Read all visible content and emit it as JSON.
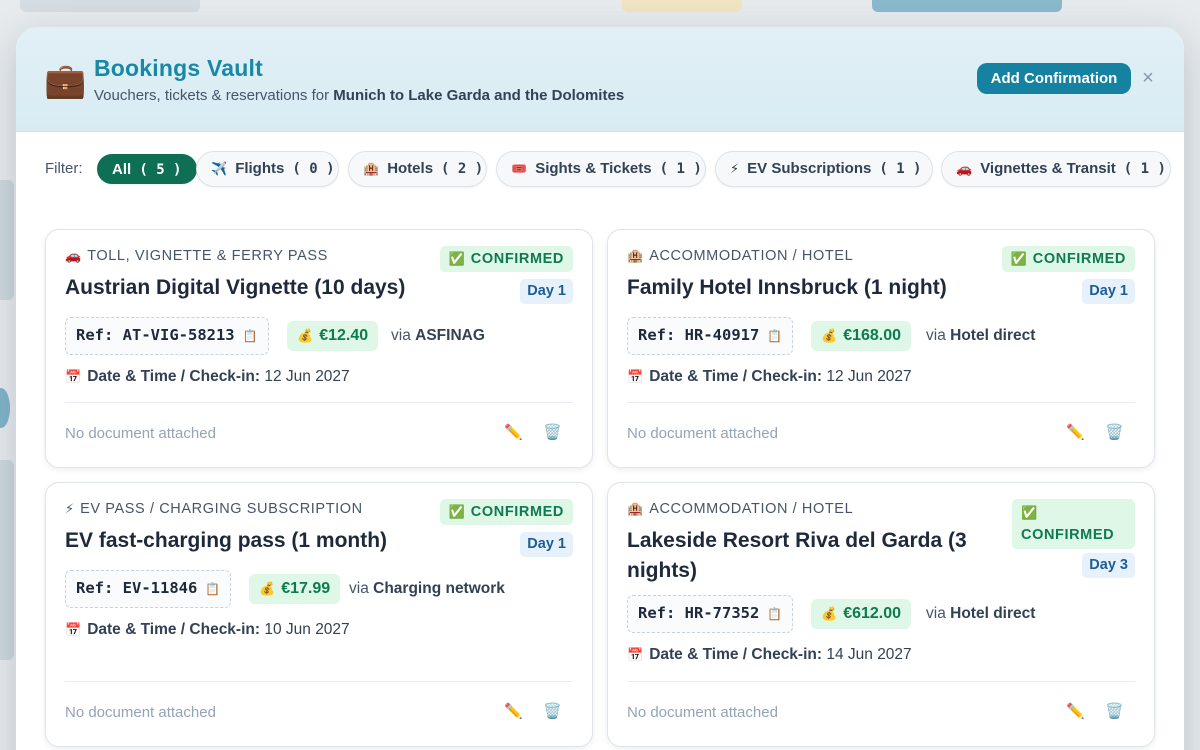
{
  "header": {
    "title": "Bookings Vault",
    "subtitle_prefix": "Vouchers, tickets & reservations for",
    "trip_name": "Munich to Lake Garda and the Dolomites",
    "add_label": "Add Confirmation",
    "close_label": "×",
    "icon": "💼"
  },
  "filters": {
    "label": "Filter:",
    "items": [
      {
        "icon": "",
        "label": "All",
        "count": "( 5 )",
        "active": true
      },
      {
        "icon": "✈️",
        "label": "Flights",
        "count": "( 0 )"
      },
      {
        "icon": "🏨",
        "label": "Hotels",
        "count": "( 2 )"
      },
      {
        "icon": "🎟️",
        "label": "Sights & Tickets",
        "count": "( 1 )"
      },
      {
        "icon": "⚡",
        "label": "EV Subscriptions",
        "count": "( 1 )"
      },
      {
        "icon": "🚗",
        "label": "Vignettes & Transit",
        "count": "( 1 )"
      }
    ]
  },
  "labels": {
    "datetime": "Date & Time / Check-in:",
    "no_doc": "No document attached",
    "via": "via",
    "edit_icon": "✏️",
    "delete_icon": "🗑️",
    "copy_icon": "📋",
    "money_icon": "💰",
    "calendar_icon": "📅",
    "check_icon": "✅"
  },
  "colors": {
    "accent": "#1582a1",
    "active_filter": "#0f6f55",
    "confirmed_bg": "#def7e7",
    "confirmed_text": "#0e7a4f",
    "day_bg": "#e7f1fb",
    "day_text": "#1d5d96"
  },
  "bookings": [
    {
      "category_icon": "🚗",
      "category": "TOLL, VIGNETTE & FERRY PASS",
      "title": "Austrian Digital Vignette (10 days)",
      "status": "CONFIRMED",
      "day": "Day 1",
      "ref": "Ref: AT-VIG-58213",
      "price": "€12.40",
      "provider": "ASFINAG",
      "date": "12 Jun 2027"
    },
    {
      "category_icon": "🏨",
      "category": "ACCOMMODATION / HOTEL",
      "title": "Family Hotel Innsbruck (1 night)",
      "status": "CONFIRMED",
      "day": "Day 1",
      "ref": "Ref: HR-40917",
      "price": "€168.00",
      "provider": "Hotel direct",
      "date": "12 Jun 2027"
    },
    {
      "category_icon": "⚡",
      "category": "EV PASS / CHARGING SUBSCRIPTION",
      "title": "EV fast-charging pass (1 month)",
      "status": "CONFIRMED",
      "day": "Day 1",
      "ref": "Ref: EV-11846",
      "price": "€17.99",
      "provider": "Charging network",
      "date": "10 Jun 2027"
    },
    {
      "category_icon": "🏨",
      "category": "ACCOMMODATION / HOTEL",
      "title": "Lakeside Resort Riva del Garda (3 nights)",
      "status": "CONFIRMED",
      "day": "Day 3",
      "ref": "Ref: HR-77352",
      "price": "€612.00",
      "provider": "Hotel direct",
      "date": "14 Jun 2027"
    }
  ]
}
